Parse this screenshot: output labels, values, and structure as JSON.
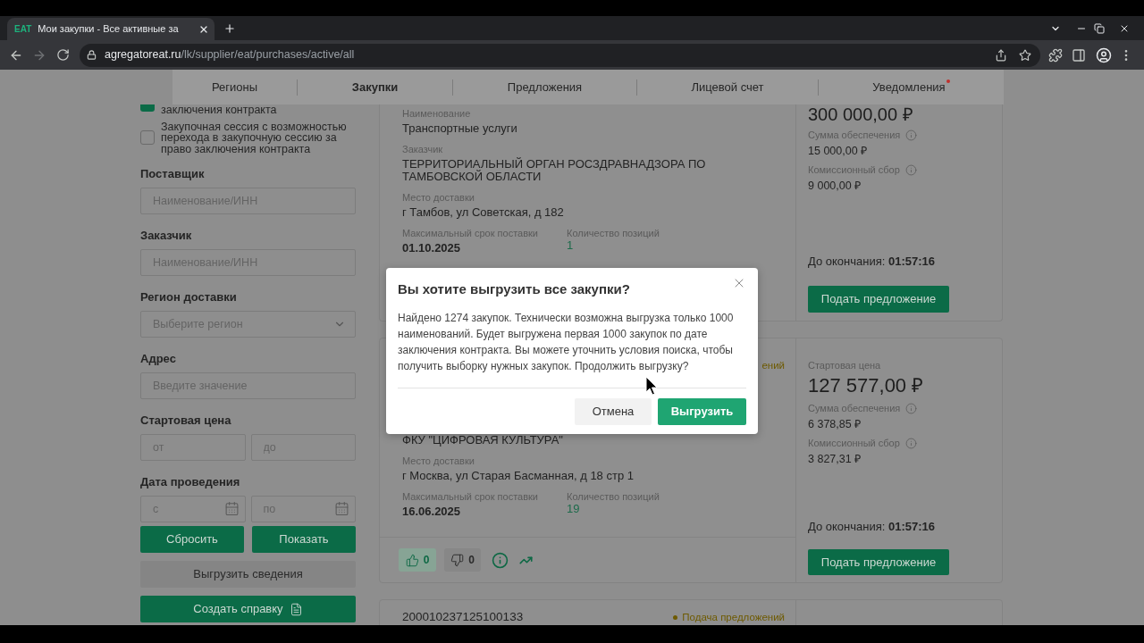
{
  "browser": {
    "tab": {
      "logo": "EAT",
      "title": "Мои закупки - Все активные за"
    },
    "url_host": "agregatoreat.ru",
    "url_path": "/lk/supplier/eat/purchases/active/all"
  },
  "nav": [
    {
      "label": "Регионы",
      "selected": false,
      "notification": false
    },
    {
      "label": "Закупки",
      "selected": true,
      "notification": false
    },
    {
      "label": "Предложения",
      "selected": false,
      "notification": false
    },
    {
      "label": "Лицевой счет",
      "selected": false,
      "notification": false
    },
    {
      "label": "Уведомления",
      "selected": false,
      "notification": true
    }
  ],
  "filters": {
    "checkboxes": [
      {
        "label": "заключения контракта",
        "checked": true
      },
      {
        "label": "Закупочная сессия с возможностью перехода в закупочную сессию за право заключения контракта",
        "checked": false
      }
    ],
    "fields": [
      {
        "kind": "text",
        "label": "Поставщик",
        "placeholder": "Наименование/ИНН"
      },
      {
        "kind": "text",
        "label": "Заказчик",
        "placeholder": "Наименование/ИНН"
      },
      {
        "kind": "select",
        "label": "Регион доставки",
        "placeholder": "Выберите регион"
      },
      {
        "kind": "text",
        "label": "Адрес",
        "placeholder": "Введите значение"
      },
      {
        "kind": "range",
        "label": "Стартовая цена",
        "placeholders": [
          "от",
          "до"
        ]
      },
      {
        "kind": "date_range",
        "label": "Дата проведения",
        "placeholders": [
          "с",
          "по"
        ]
      }
    ],
    "actions": [
      "Сбросить",
      "Показать"
    ],
    "export_button": "Выгрузить сведения",
    "report_button": "Создать справку"
  },
  "purchases": [
    {
      "fields": [
        {
          "label": "Наименование",
          "value": "Транспортные услуги"
        },
        {
          "label": "Заказчик",
          "value": "ТЕРРИТОРИАЛЬНЫЙ ОРГАН РОСЗДРАВНАДЗОРА ПО ТАМБОВСКОЙ ОБЛАСТИ"
        },
        {
          "label": "Место доставки",
          "value": "г Тамбов, ул Советская, д 182"
        }
      ],
      "deadline_label": "Максимальный срок поставки",
      "deadline": "01.10.2025",
      "positions_label": "Количество позиций",
      "positions": "1",
      "price": "300 000,00 ₽",
      "security_label": "Сумма обеспечения",
      "security": "15 000,00 ₽",
      "fee_label": "Комиссионный сбор",
      "fee": "9 000,00 ₽",
      "ends": "До окончания: **01:57:16**",
      "submit": "Подать предложение"
    },
    {
      "status": "ений",
      "fields": [
        {
          "value": "ФКУ \"ЦИФРОВАЯ КУЛЬТУРА\""
        },
        {
          "label": "Место доставки",
          "value": "г Москва, ул Старая Басманная, д 18 стр 1"
        }
      ],
      "deadline_label": "Максимальный срок поставки",
      "deadline": "16.06.2025",
      "positions_label": "Количество позиций",
      "positions": "19",
      "price_label": "Стартовая цена",
      "price": "127 577,00 ₽",
      "security_label": "Сумма обеспечения",
      "security": "6 378,85 ₽",
      "fee_label": "Комиссионный сбор",
      "fee": "3 827,31 ₽",
      "ends": "До окончания: **01:57:16**",
      "submit": "Подать предложение",
      "likes": "0",
      "dislikes": "0"
    },
    {
      "number": "200010237125100133",
      "status": "Подача предложений"
    }
  ],
  "dialog": {
    "title": "Вы хотите выгрузить все закупки?",
    "body": "Найдено 1274 закупок. Технически возможна выгрузка только 1000 наименований. Будет выгружена первая 1000 закупок по дате заключения контракта. Вы можете уточнить условия поиска, чтобы получить выборку нужных закупок. Продолжить выгрузку?",
    "buttons": [
      {
        "label": "Отмена",
        "kind": "secondary"
      },
      {
        "label": "Выгрузить",
        "kind": "primary"
      }
    ]
  }
}
